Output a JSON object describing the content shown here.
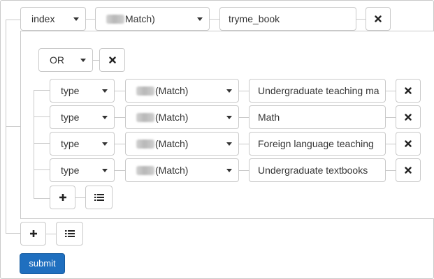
{
  "root": {
    "field": "index",
    "match_op": "Match)",
    "value": "tryme_book"
  },
  "group": {
    "logic": "OR",
    "conditions": [
      {
        "field": "type",
        "match_op": "(Match)",
        "value": "Undergraduate teaching ma"
      },
      {
        "field": "type",
        "match_op": "(Match)",
        "value": "Math"
      },
      {
        "field": "type",
        "match_op": "(Match)",
        "value": "Foreign language teaching"
      },
      {
        "field": "type",
        "match_op": "(Match)",
        "value": "Undergraduate textbooks"
      }
    ]
  },
  "icons": {
    "remove": "times-icon",
    "add": "plus-icon",
    "group": "list-icon"
  },
  "submit_label": "submit",
  "colors": {
    "border": "#c9c9c9",
    "primary": "#1f6fbf"
  }
}
